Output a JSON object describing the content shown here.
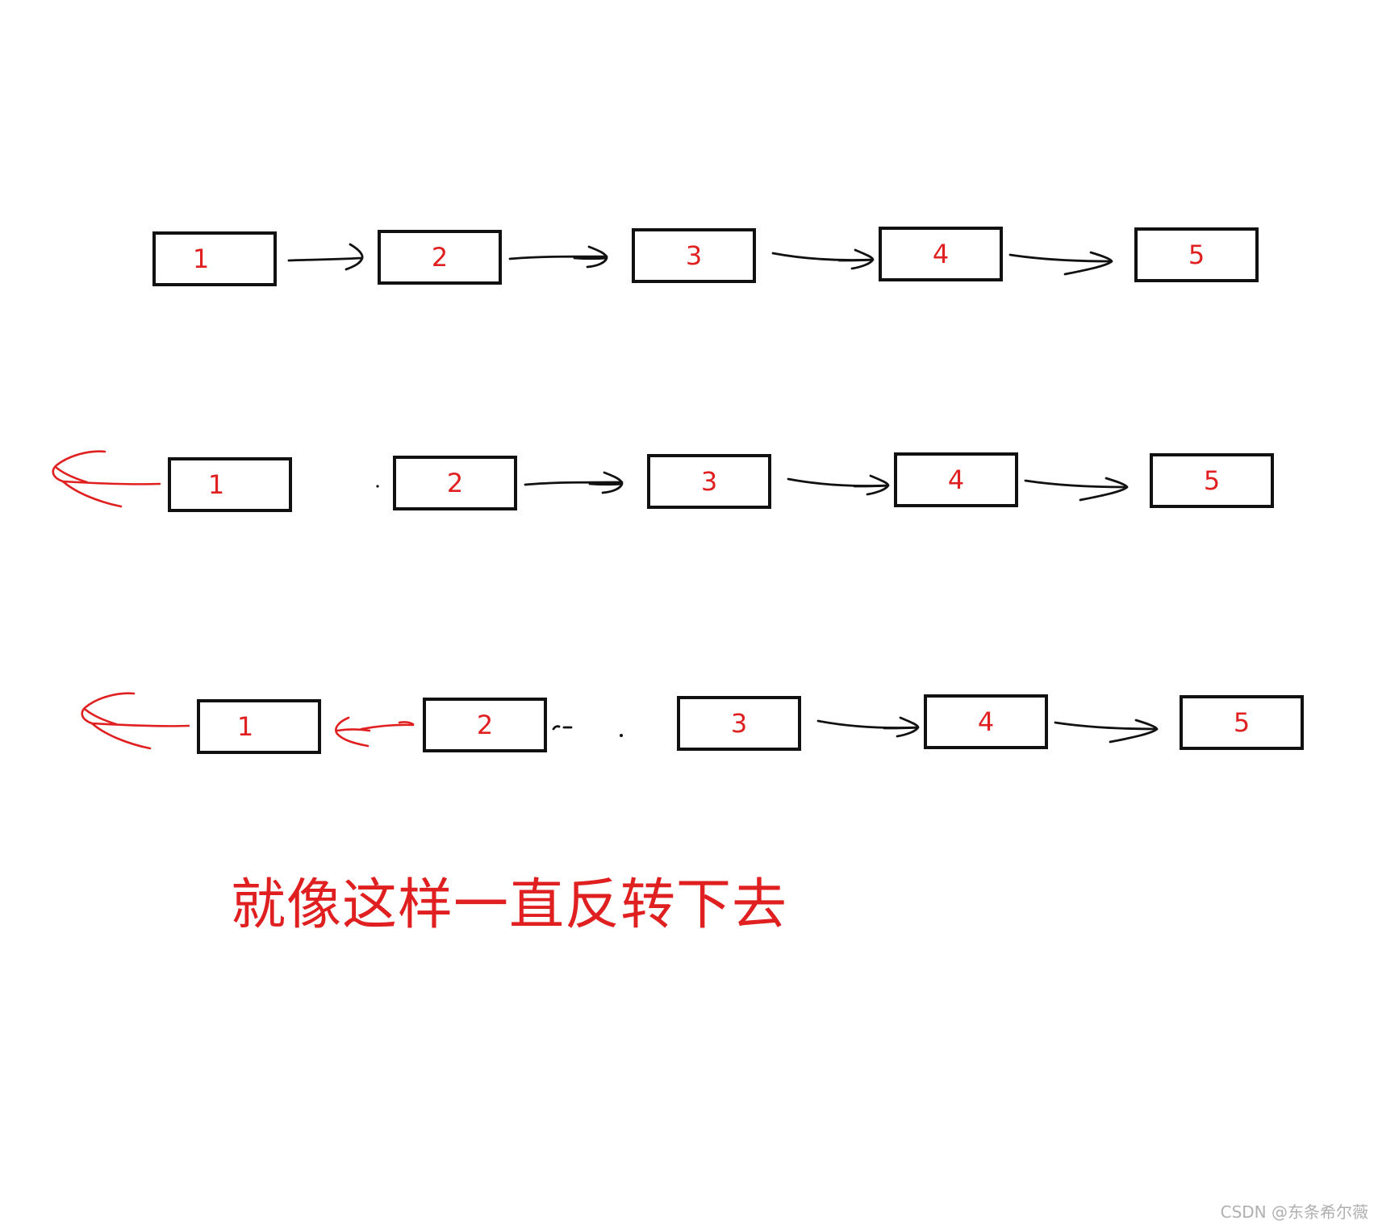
{
  "colors": {
    "ink": "#111111",
    "accent": "#e02020",
    "watermark": "#b0b0b0",
    "background": "#ffffff"
  },
  "rows": [
    {
      "nodes": [
        "1",
        "2",
        "3",
        "4",
        "5"
      ]
    },
    {
      "nodes": [
        "1",
        "2",
        "3",
        "4",
        "5"
      ]
    },
    {
      "nodes": [
        "1",
        "2",
        "3",
        "4",
        "5"
      ]
    }
  ],
  "caption": "就像这样一直反转下去",
  "watermark": "CSDN @东条希尔薇"
}
